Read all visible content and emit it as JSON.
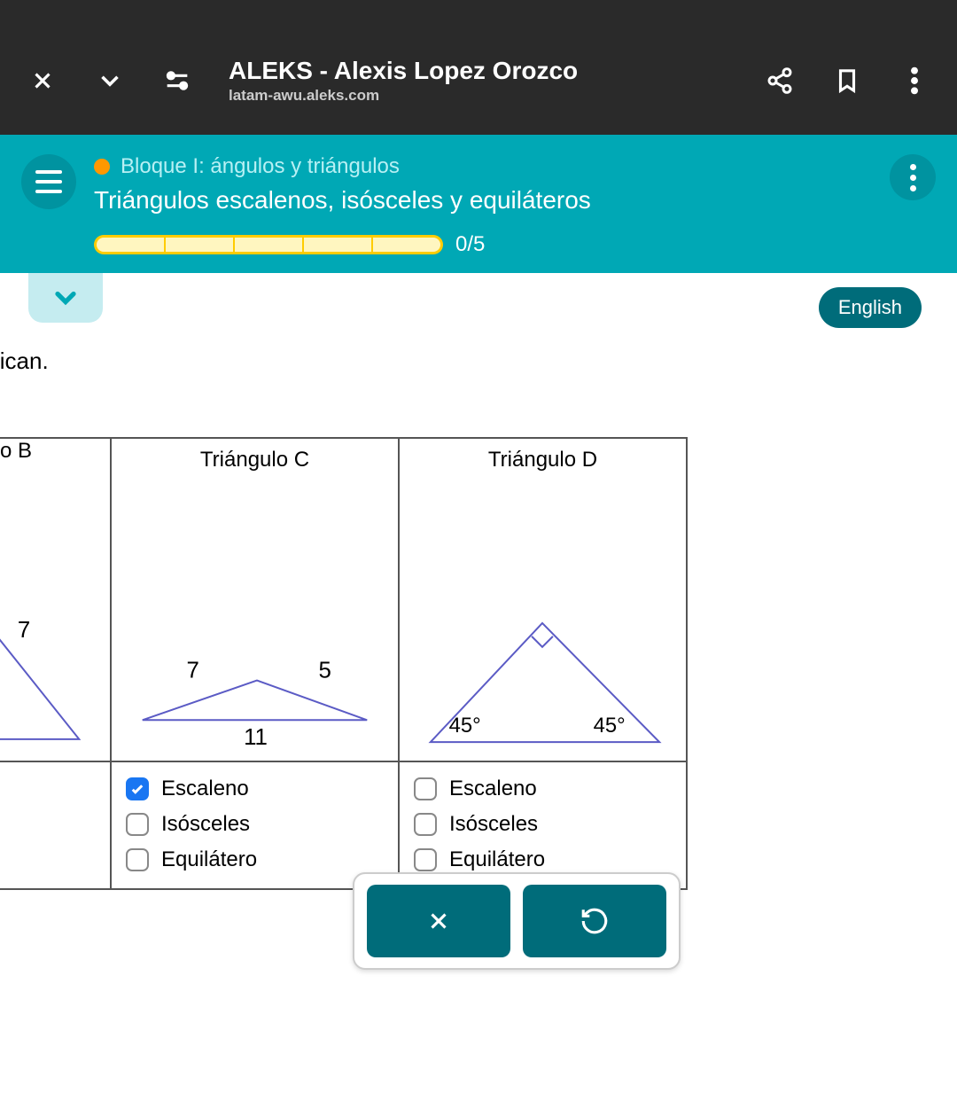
{
  "browser": {
    "title": "ALEKS - Alexis Lopez Orozco",
    "subtitle": "latam-awu.aleks.com"
  },
  "app_header": {
    "breadcrumb": "Bloque I: ángulos y triángulos",
    "section_title": "Triángulos escalenos, isósceles y equiláteros",
    "progress": "0/5"
  },
  "language_button": "English",
  "truncated_instruction": "lican.",
  "triangles": {
    "b": {
      "header": "o B",
      "side1": "7"
    },
    "c": {
      "header": "Triángulo C",
      "side1": "7",
      "side2": "5",
      "side3": "11"
    },
    "d": {
      "header": "Triángulo D",
      "angle1": "45°",
      "angle2": "45°"
    }
  },
  "options": {
    "escaleno": "Escaleno",
    "isosceles": "Isósceles",
    "equilatero": "Equilátero"
  },
  "checked": {
    "c_escaleno": true
  }
}
